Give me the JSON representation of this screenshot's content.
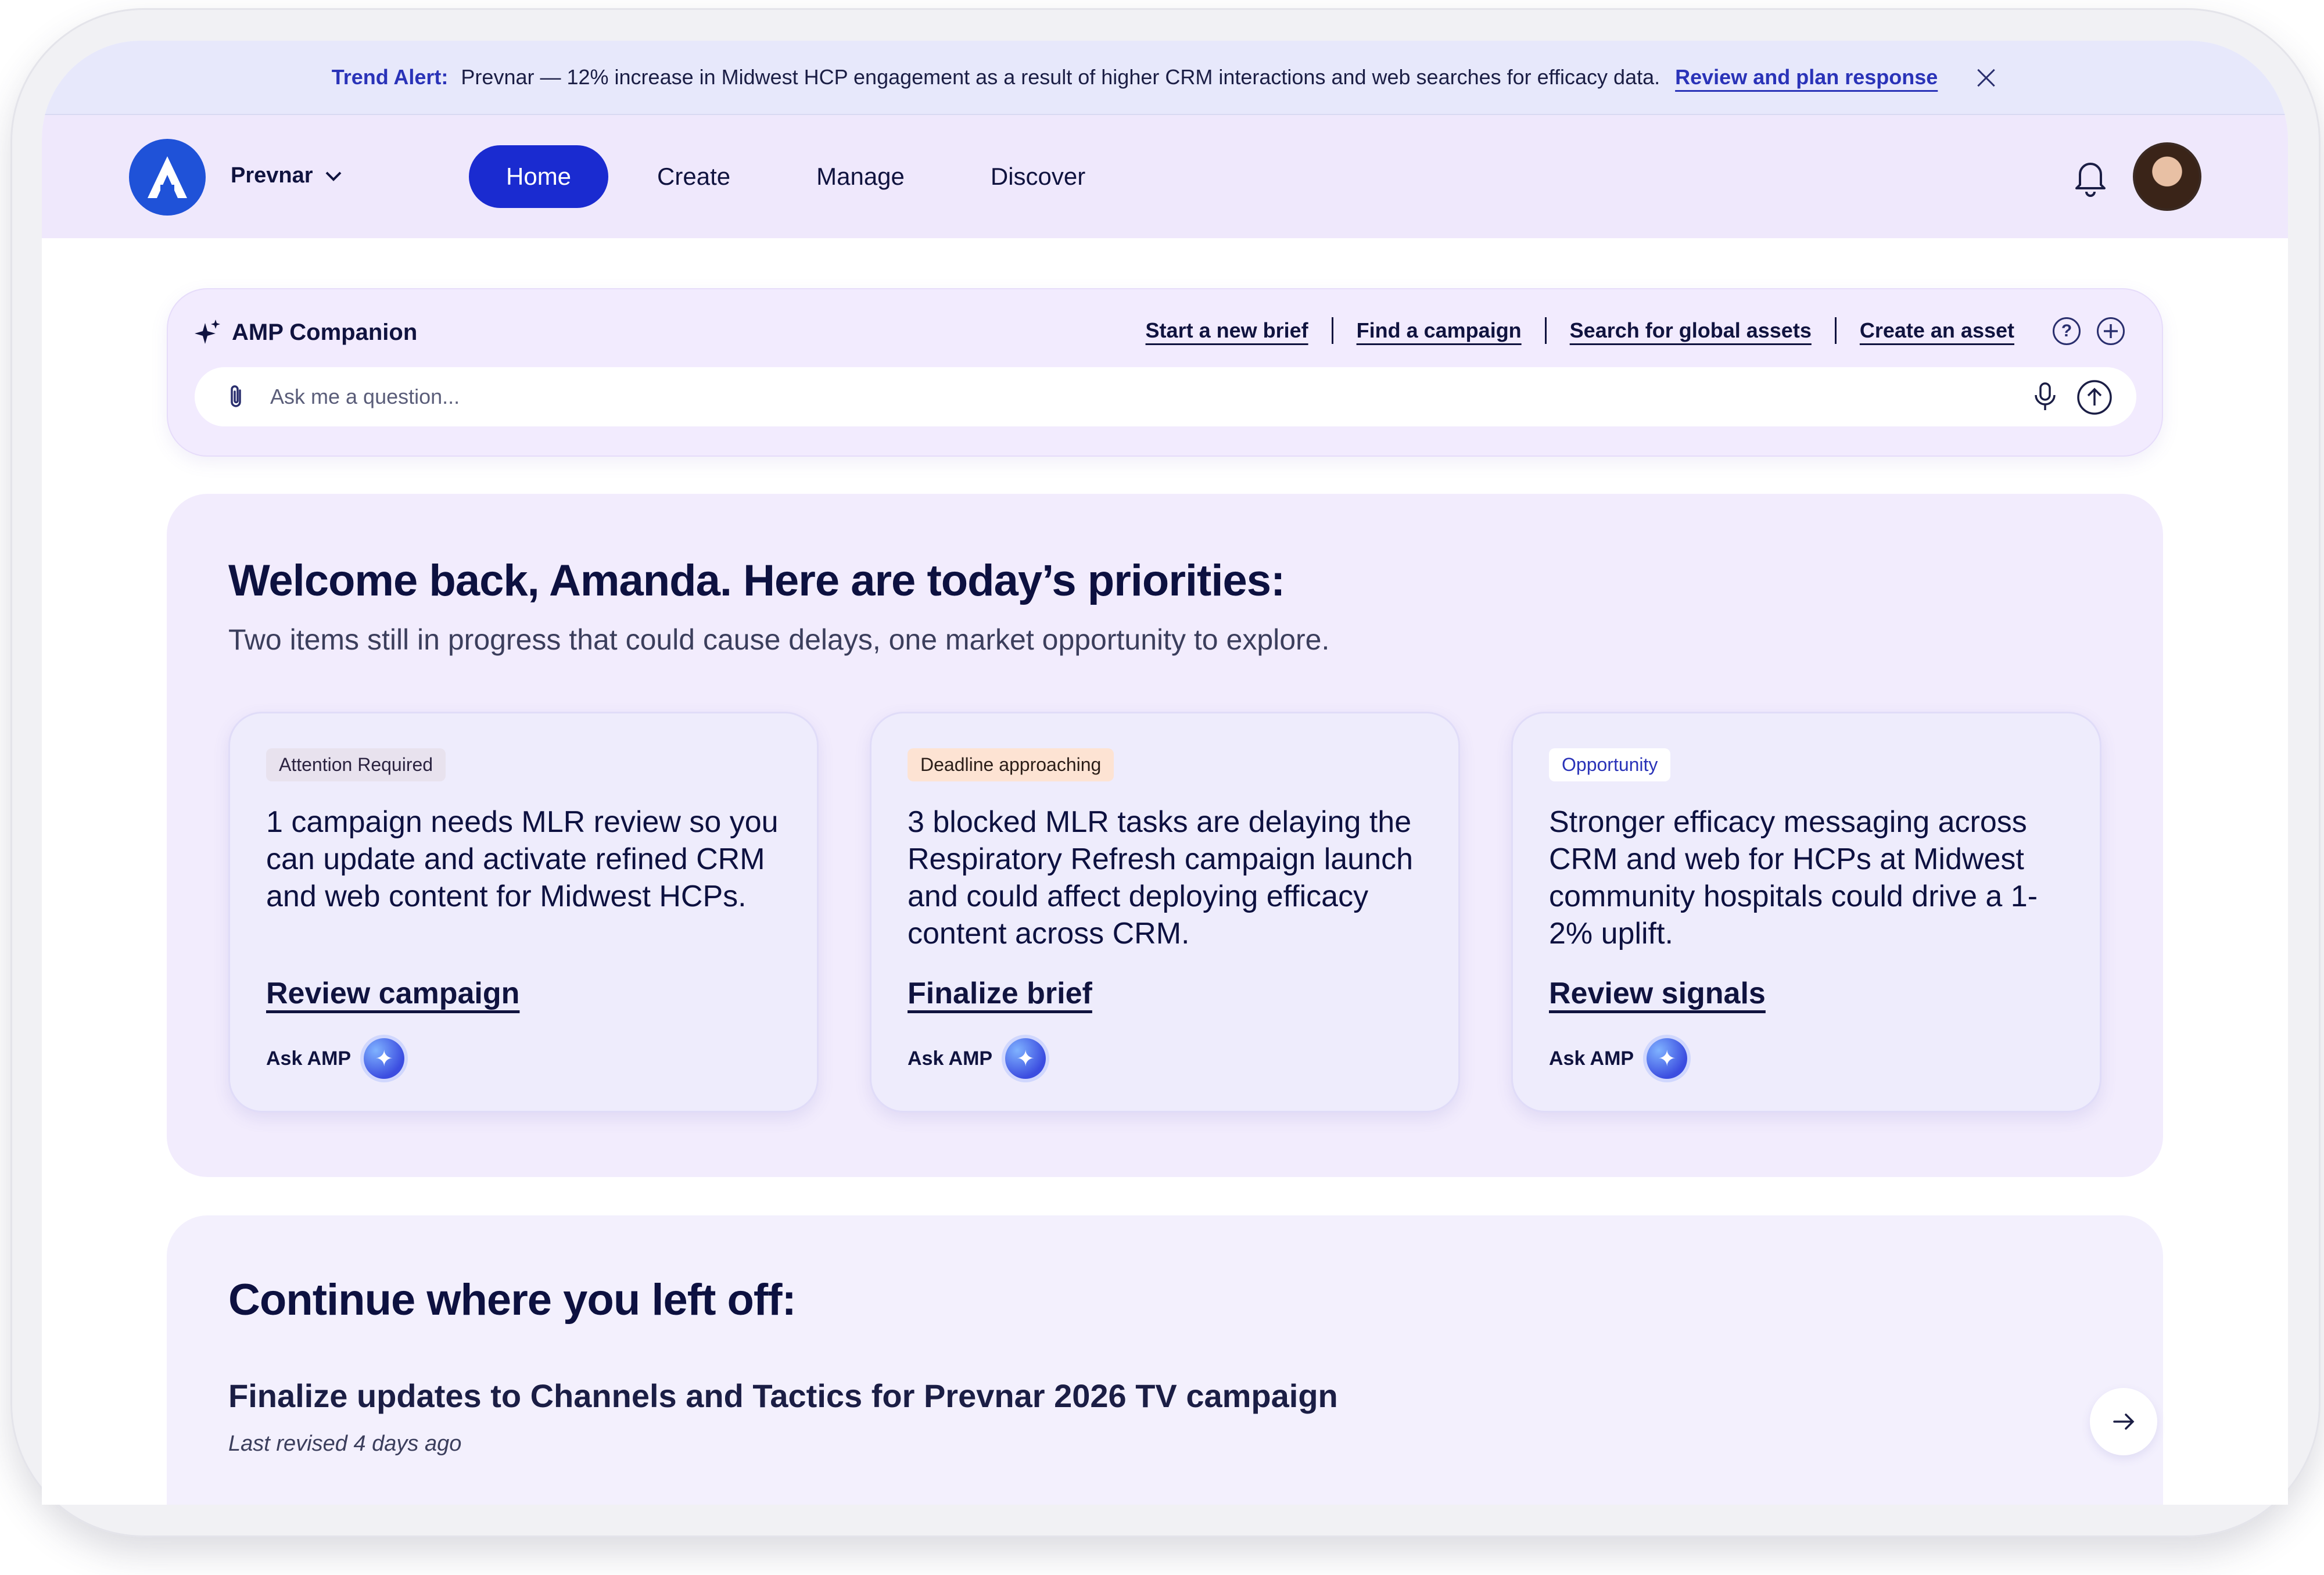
{
  "alert": {
    "label": "Trend Alert:",
    "text": "Prevnar — 12% increase in Midwest HCP engagement as a result of higher CRM interactions and web searches for efficacy data.",
    "link": "Review and plan response"
  },
  "header": {
    "brand": "Prevnar",
    "nav": [
      "Home",
      "Create",
      "Manage",
      "Discover"
    ],
    "active_nav": "Home"
  },
  "companion": {
    "title": "AMP Companion",
    "links": [
      "Start a new brief",
      "Find a campaign",
      "Search for global assets",
      "Create an asset"
    ],
    "placeholder": "Ask me a question...",
    "help_icon": "?"
  },
  "priorities": {
    "title": "Welcome back, Amanda. Here are today’s priorities:",
    "subtitle": "Two items still in progress that could cause delays, one market opportunity to explore.",
    "cards": [
      {
        "tag": "Attention Required",
        "text": "1 campaign needs MLR review so you can update and activate refined CRM and web content for Midwest HCPs.",
        "link": "Review campaign",
        "ask": "Ask AMP"
      },
      {
        "tag": "Deadline approaching",
        "text": "3 blocked MLR tasks are delaying the Respiratory Refresh campaign launch and could affect deploying efficacy content across CRM.",
        "link": "Finalize brief",
        "ask": "Ask AMP"
      },
      {
        "tag": "Opportunity",
        "text": "Stronger efficacy messaging across CRM and web for HCPs at Midwest community hospitals could drive a 1-2% uplift.",
        "link": "Review signals",
        "ask": "Ask AMP"
      }
    ]
  },
  "continue": {
    "title": "Continue where you left off:",
    "items": [
      {
        "title": "Finalize updates to Channels and Tactics for Prevnar 2026 TV campaign",
        "meta": "Last revised 4 days ago"
      }
    ]
  },
  "colors": {
    "accent": "#1a2bd0",
    "alert_bg": "#e7e8fb",
    "header_bg": "#efe8fc",
    "panel_bg": "#f2ecfd"
  }
}
